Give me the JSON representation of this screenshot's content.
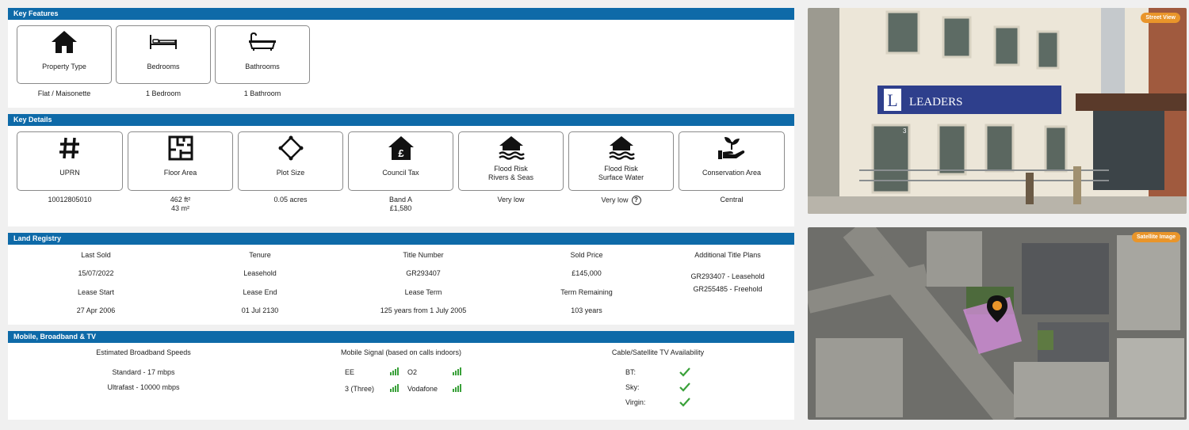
{
  "key_features": {
    "title": "Key Features",
    "tiles": [
      {
        "label": "Property Type",
        "value": "Flat / Maisonette",
        "icon": "house-icon"
      },
      {
        "label": "Bedrooms",
        "value": "1 Bedroom",
        "icon": "bed-icon"
      },
      {
        "label": "Bathrooms",
        "value": "1 Bathroom",
        "icon": "bathtub-icon"
      }
    ]
  },
  "key_details": {
    "title": "Key Details",
    "tiles": [
      {
        "label": "UPRN",
        "value": "10012805010",
        "icon": "hash-icon"
      },
      {
        "label": "Floor Area",
        "value": "462 ft²",
        "value2": "43 m²",
        "icon": "floor-plan-icon"
      },
      {
        "label": "Plot Size",
        "value": "0.05 acres",
        "icon": "plot-diamond-icon"
      },
      {
        "label": "Council Tax",
        "value": "Band A",
        "value2": "£1,580",
        "icon": "pound-house-icon"
      },
      {
        "label": "Flood Risk",
        "label2": "Rivers & Seas",
        "value": "Very low",
        "icon": "flood-house-icon"
      },
      {
        "label": "Flood Risk",
        "label2": "Surface Water",
        "value": "Very low",
        "help": "?",
        "icon": "flood-house-icon"
      },
      {
        "label": "Conservation Area",
        "value": "Central",
        "icon": "hand-plant-icon"
      }
    ]
  },
  "land_registry": {
    "title": "Land Registry",
    "row1_headers": [
      "Last Sold",
      "Tenure",
      "Title Number",
      "Sold Price",
      "Additional Title Plans"
    ],
    "row1_values": [
      "15/07/2022",
      "Leasehold",
      "GR293407",
      "£145,000"
    ],
    "row2_headers": [
      "Lease Start",
      "Lease End",
      "Lease Term",
      "Term Remaining"
    ],
    "row2_values": [
      "27 Apr 2006",
      "01 Jul 2130",
      "125 years from 1 July 2005",
      "103 years"
    ],
    "additional_plans": [
      "GR293407 - Leasehold",
      "GR255485 - Freehold"
    ]
  },
  "mobile": {
    "title": "Mobile, Broadband & TV",
    "broadband_header": "Estimated Broadband Speeds",
    "broadband": [
      "Standard - 17 mbps",
      "Ultrafast - 10000 mbps"
    ],
    "signal_header": "Mobile Signal (based on calls indoors)",
    "networks": [
      "EE",
      "O2",
      "3 (Three)",
      "Vodafone"
    ],
    "tv_header": "Cable/Satellite TV Availability",
    "tv": [
      "BT:",
      "Sky:",
      "Virgin:"
    ],
    "signal_color": "#3aa13a",
    "check_color": "#3aa13a"
  },
  "street_view": {
    "button": "Street View",
    "sign_text": "LEADERS",
    "sign_letter": "L",
    "door_number": "3"
  },
  "satellite": {
    "button": "Satellite Image"
  },
  "colors": {
    "header_blue": "#0e6aa8",
    "pill_orange": "#e9952a",
    "highlight_pink": "#d88fe0"
  }
}
